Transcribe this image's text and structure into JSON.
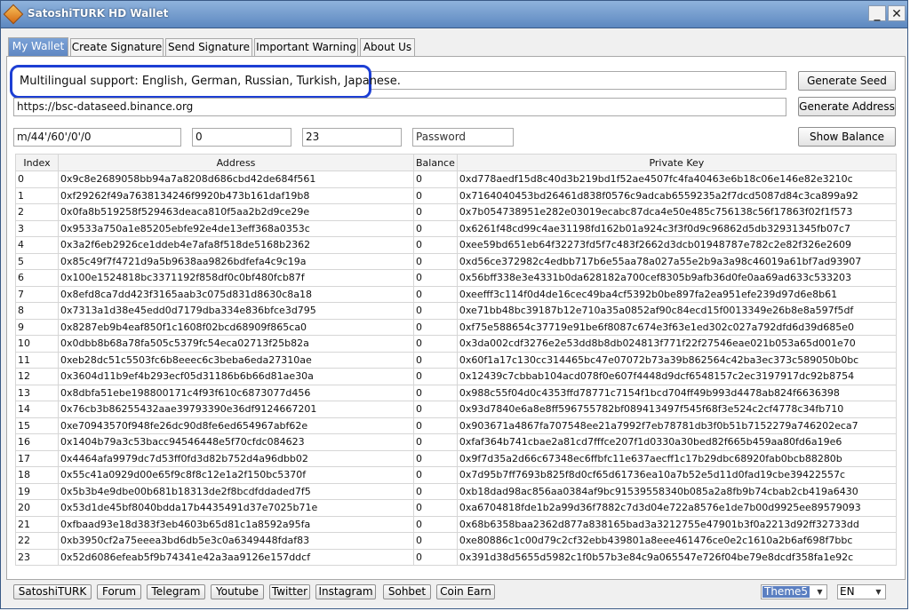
{
  "window": {
    "title": "SatoshiTURK HD Wallet",
    "minimize": "_",
    "close": "✕"
  },
  "tabs": [
    {
      "label": "My Wallet",
      "active": true
    },
    {
      "label": "Create Signature",
      "active": false
    },
    {
      "label": "Send Signature",
      "active": false
    },
    {
      "label": "Important Warning",
      "active": false
    },
    {
      "label": "About Us",
      "active": false
    }
  ],
  "form": {
    "seed_text": "Multilingual support: English, German, Russian, Turkish, Japanese.",
    "rpc_url": "https://bsc-dataseed.binance.org",
    "path": "m/44'/60'/0'/0",
    "start_index": "0",
    "count": "23",
    "password_placeholder": "Password",
    "generate_seed": "Generate Seed",
    "generate_address": "Generate Address",
    "show_balance": "Show Balance"
  },
  "table": {
    "headers": [
      "Index",
      "Address",
      "Balance",
      "Private Key"
    ],
    "rows": [
      [
        "0",
        "0x9c8e2689058bb94a7a8208d686cbd42de684f561",
        "0",
        "0xd778aedf15d8c40d3b219bd1f52ae4507fc4fa40463e6b18c06e146e82e3210c"
      ],
      [
        "1",
        "0xf29262f49a7638134246f9920b473b161daf19b8",
        "0",
        "0x7164040453bd26461d838f0576c9adcab6559235a2f7dcd5087d84c3ca899a92"
      ],
      [
        "2",
        "0x0fa8b519258f529463deaca810f5aa2b2d9ce29e",
        "0",
        "0x7b054738951e282e03019ecabc87dca4e50e485c756138c56f17863f02f1f573"
      ],
      [
        "3",
        "0x9533a750a1e85205ebfe92e4de13eff368a0353c",
        "0",
        "0x6261f48cd99c4ae31198fd162b01a924c3f3f0d9c96862d5db32931345fb07c7"
      ],
      [
        "4",
        "0x3a2f6eb2926ce1ddeb4e7afa8f518de5168b2362",
        "0",
        "0xee59bd651eb64f32273fd5f7c483f2662d3dcb01948787e782c2e82f326e2609"
      ],
      [
        "5",
        "0x85c49f7f4721d9a5b9638aa9826bdfefa4c9c19a",
        "0",
        "0xd56ce372982c4edbb717b6e55aa78a027a55e2b9a3a98c46019a61bf7ad93907"
      ],
      [
        "6",
        "0x100e1524818bc3371192f858df0c0bf480fcb87f",
        "0",
        "0x56bff338e3e4331b0da628182a700cef8305b9afb36d0fe0aa69ad633c533203"
      ],
      [
        "7",
        "0x8efd8ca7dd423f3165aab3c075d831d8630c8a18",
        "0",
        "0xeefff3c114f0d4de16cec49ba4cf5392b0be897fa2ea951efe239d97d6e8b61"
      ],
      [
        "8",
        "0x7313a1d38e45edd0d7179dba334e836bfce3d795",
        "0",
        "0xe71bb48bc39187b12e710a35a0852af90c84ecd15f0013349e26b8e8a597f5df"
      ],
      [
        "9",
        "0x8287eb9b4eaf850f1c1608f02bcd68909f865ca0",
        "0",
        "0xf75e588654c37719e91be6f8087c674e3f63e1ed302c027a792dfd6d39d685e0"
      ],
      [
        "10",
        "0x0dbb8b68a78fa505c5379fc54eca02713f25b82a",
        "0",
        "0x3da002cdf3276e2e53dd8b8db024813f771f22f27546eae021b053a65d001e70"
      ],
      [
        "11",
        "0xeb28dc51c5503fc6b8eeec6c3beba6eda27310ae",
        "0",
        "0x60f1a17c130cc314465bc47e07072b73a39b862564c42ba3ec373c589050b0bc"
      ],
      [
        "12",
        "0x3604d11b9ef4b293ecf05d31186b6b66d81ae30a",
        "0",
        "0x12439c7cbbab104acd078f0e607f4448d9dcf6548157c2ec3197917dc92b8754"
      ],
      [
        "13",
        "0x8dbfa51ebe198800171c4f93f610c6873077d456",
        "0",
        "0x988c55f04d0c4353ffd78771c7154f1bcd704ff49b993d4478ab824f6636398"
      ],
      [
        "14",
        "0x76cb3b86255432aae39793390e36df9124667201",
        "0",
        "0x93d7840e6a8e8ff596755782bf089413497f545f68f3e524c2cf4778c34fb710"
      ],
      [
        "15",
        "0xe70943570f948fe26dc90d8fe6ed654967abf62e",
        "0",
        "0x903671a4867fa707548ee21a7992f7eb78781db3f0b51b7152279a746202eca7"
      ],
      [
        "16",
        "0x1404b79a3c53bacc94546448e5f70cfdc084623",
        "0",
        "0xfaf364b741cbae2a81cd7fffce207f1d0330a30bed82f665b459aa80fd6a19e6"
      ],
      [
        "17",
        "0x4464afa9979dc7d53ff0fd3d82b752d4a96dbb02",
        "0",
        "0x9f7d35a2d66c67348ec6ffbfc11e637aecff1c17b29dbc68920fab0bcb88280b"
      ],
      [
        "18",
        "0x55c41a0929d00e65f9c8f8c12e1a2f150bc5370f",
        "0",
        "0x7d95b7ff7693b825f8d0cf65d61736ea10a7b52e5d11d0fad19cbe39422557c"
      ],
      [
        "19",
        "0x5b3b4e9dbe00b681b18313de2f8bcdfddaded7f5",
        "0",
        "0xb18dad98ac856aa0384af9bc91539558340b085a2a8fb9b74cbab2cb419a6430"
      ],
      [
        "20",
        "0x53d1de45bf8040bdda17b4435491d37e7025b71e",
        "0",
        "0xa6704818fde1b2a99d36f7882c7d3d04e722a8576e1de7b00d9925ee89579093"
      ],
      [
        "21",
        "0xfbaad93e18d383f3eb4603b65d81c1a8592a95fa",
        "0",
        "0x68b6358baa2362d877a838165bad3a3212755e47901b3f0a2213d92ff32733dd"
      ],
      [
        "22",
        "0xb3950cf2a75eeea3bd6db5e3c0a6349448fdaf83",
        "0",
        "0xe80886c1c00d79c2cf32ebb439801a8eee461476ce0e2c1610a2b6af698f7bbc"
      ],
      [
        "23",
        "0x52d6086efeab5f9b74341e42a3aa9126e157ddcf",
        "0",
        "0x391d38d5655d5982c1f0b57b3e84c9a065547e726f04be79e8dcdf358fa1e92c"
      ]
    ]
  },
  "footer": {
    "links": [
      "SatoshiTURK",
      "Forum",
      "Telegram",
      "Youtube",
      "Twitter",
      "Instagram",
      "Sohbet",
      "Coin Earn"
    ],
    "theme": "Theme5",
    "language": "EN"
  }
}
